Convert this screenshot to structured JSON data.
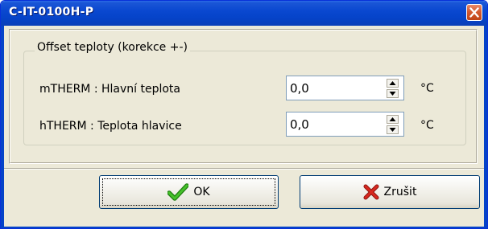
{
  "window": {
    "title": "C-IT-0100H-P",
    "close_icon": "close-icon"
  },
  "group": {
    "label": "Offset teploty (korekce +-)"
  },
  "rows": [
    {
      "label": "mTHERM : Hlavní teplota",
      "value": "0,0",
      "unit": "°C"
    },
    {
      "label": "hTHERM : Teplota hlavice",
      "value": "0,0",
      "unit": "°C"
    }
  ],
  "buttons": {
    "ok_label": "OK",
    "ok_icon": "checkmark-icon",
    "cancel_label": "Zrušit",
    "cancel_icon": "red-x-icon"
  },
  "colors": {
    "titlebar": "#0543c8",
    "face": "#ece9d8",
    "ok_check": "#2e9e1a",
    "cancel_x": "#c8201a"
  }
}
